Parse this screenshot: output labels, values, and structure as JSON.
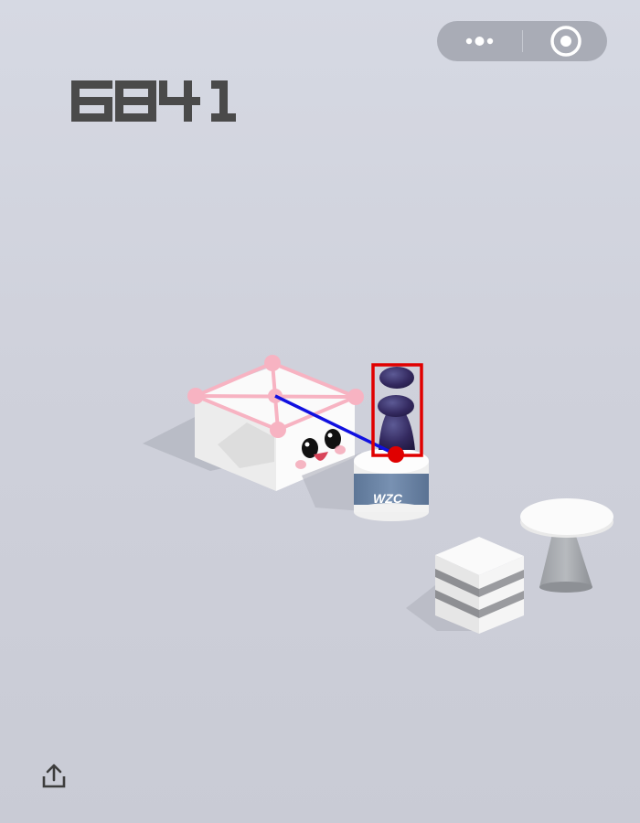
{
  "app": {
    "score": "6841"
  },
  "capsule": {
    "more_icon": "ellipsis-icon",
    "close_icon": "target-circle-icon"
  },
  "scene": {
    "current_platform": "box-with-face",
    "player": "dark-purple-piece",
    "platforms": [
      "cardboard-box-with-face",
      "wzc-jar",
      "striped-cube",
      "round-pedestal-table"
    ],
    "jar_label": "WZC"
  },
  "share": {
    "icon": "share-upload-icon"
  },
  "colors": {
    "background": "#d4d7e1",
    "score": "#4a4a4a",
    "overlay_pink": "#f7b3c2",
    "overlay_line": "#1010e0",
    "overlay_box": "#e00000",
    "jar_blue": "#6b86a8",
    "player": "#3a2e6a"
  }
}
